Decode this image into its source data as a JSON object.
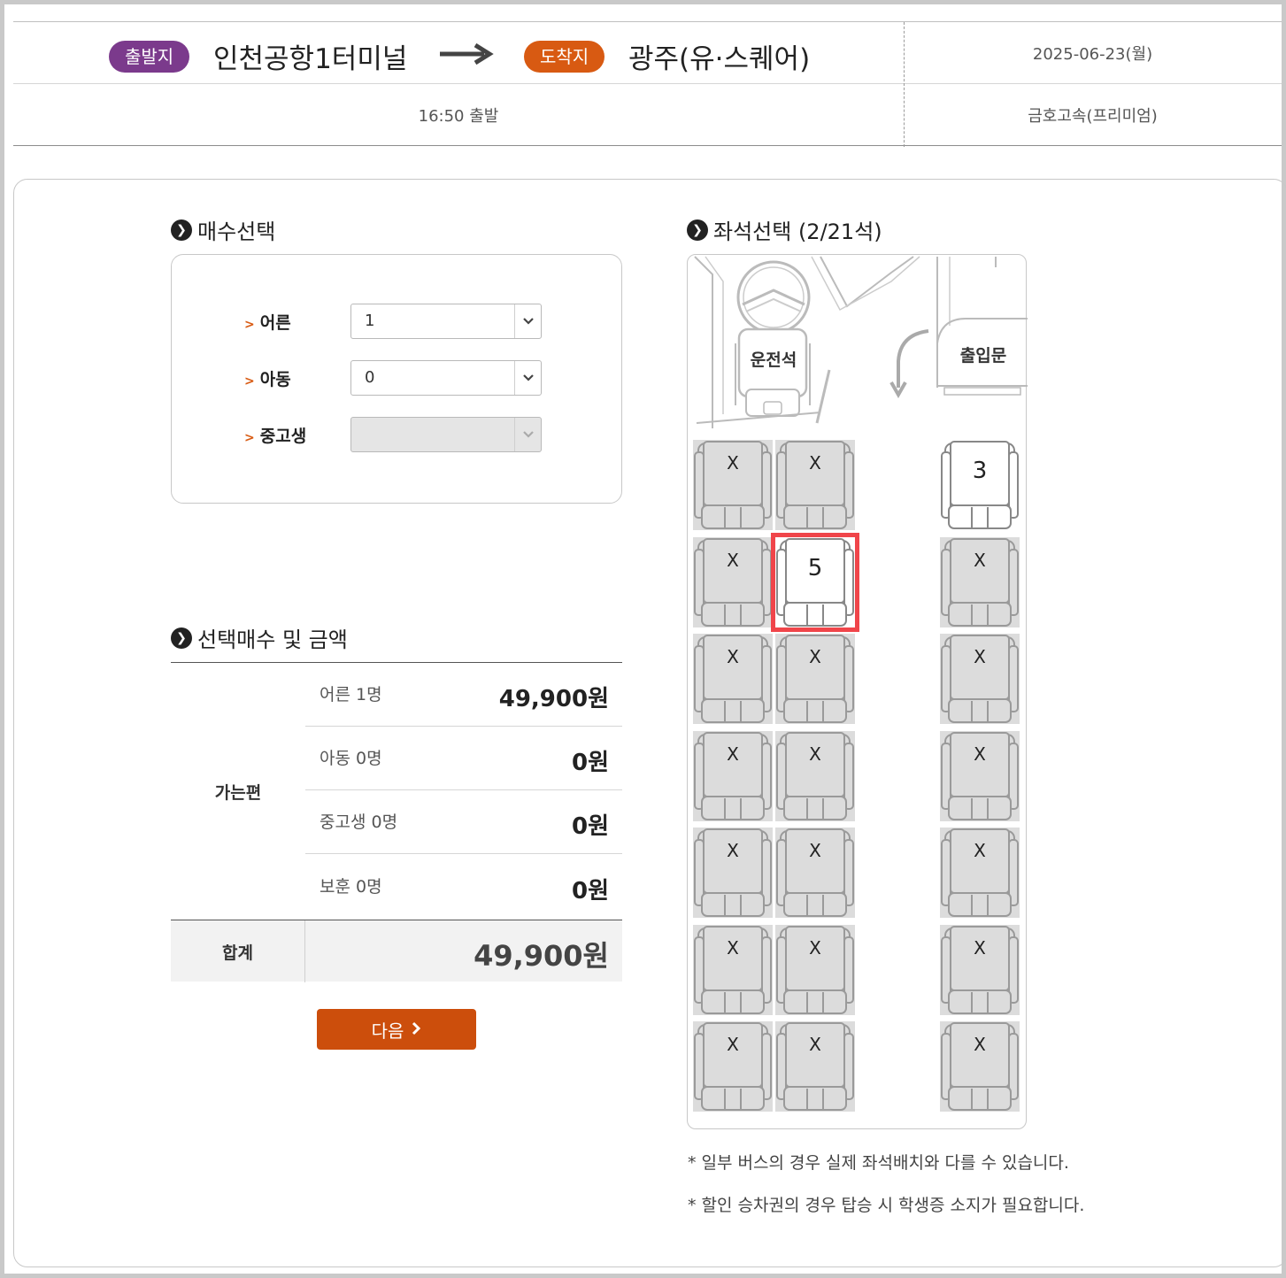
{
  "route": {
    "departure_badge": "출발지",
    "departure": "인천공항1터미널",
    "arrival_badge": "도착지",
    "arrival": "광주(유·스퀘어)",
    "date": "2025-06-23(월)",
    "time": "16:50 출발",
    "bus_grade": "금호고속(프리미엄)"
  },
  "ticket_count": {
    "title": "매수선택",
    "rows": [
      {
        "label": "어른",
        "value": "1",
        "enabled": true
      },
      {
        "label": "아동",
        "value": "0",
        "enabled": true
      },
      {
        "label": "중고생",
        "value": "",
        "enabled": false
      }
    ]
  },
  "price": {
    "title": "선택매수 및 금액",
    "direction": "가는편",
    "rows": [
      {
        "label": "어른 1명",
        "value": "49,900원"
      },
      {
        "label": "아동 0명",
        "value": "0원"
      },
      {
        "label": "중고생 0명",
        "value": "0원"
      },
      {
        "label": "보훈 0명",
        "value": "0원"
      }
    ],
    "total_label": "합계",
    "total_value": "49,900원"
  },
  "next_button": "다음",
  "seat_select": {
    "title": "좌석선택 (2/21석)",
    "driver_label": "운전석",
    "door_label": "출입문",
    "taken_mark": "X",
    "seats": [
      {
        "label": "X",
        "status": "taken"
      },
      {
        "label": "X",
        "status": "taken"
      },
      {
        "label": "3",
        "status": "available"
      },
      {
        "label": "X",
        "status": "taken"
      },
      {
        "label": "5",
        "status": "selected"
      },
      {
        "label": "X",
        "status": "taken"
      },
      {
        "label": "X",
        "status": "taken"
      },
      {
        "label": "X",
        "status": "taken"
      },
      {
        "label": "X",
        "status": "taken"
      },
      {
        "label": "X",
        "status": "taken"
      },
      {
        "label": "X",
        "status": "taken"
      },
      {
        "label": "X",
        "status": "taken"
      },
      {
        "label": "X",
        "status": "taken"
      },
      {
        "label": "X",
        "status": "taken"
      },
      {
        "label": "X",
        "status": "taken"
      },
      {
        "label": "X",
        "status": "taken"
      },
      {
        "label": "X",
        "status": "taken"
      },
      {
        "label": "X",
        "status": "taken"
      },
      {
        "label": "X",
        "status": "taken"
      },
      {
        "label": "X",
        "status": "taken"
      },
      {
        "label": "X",
        "status": "taken"
      }
    ]
  },
  "notes": [
    "* 일부 버스의 경우 실제 좌석배치와 다를 수 있습니다.",
    "* 할인 승차권의 경우 탑승 시 학생증 소지가 필요합니다."
  ],
  "colors": {
    "departure_badge": "#7b3a8c",
    "arrival_badge": "#d85a12",
    "next_button": "#cc4e0c",
    "selected_seat_outline": "#f0454a"
  }
}
